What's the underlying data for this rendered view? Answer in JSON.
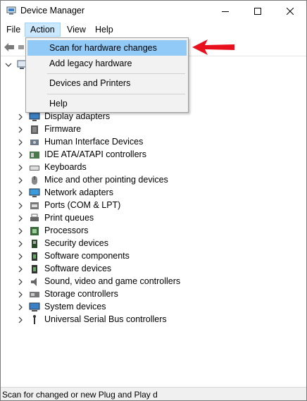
{
  "window": {
    "title": "Device Manager"
  },
  "menubar": {
    "file": "File",
    "action": "Action",
    "view": "View",
    "help": "Help"
  },
  "dropdown": {
    "scan": "Scan for hardware changes",
    "legacy": "Add legacy hardware",
    "devices_printers": "Devices and Printers",
    "help": "Help"
  },
  "tree": {
    "items": [
      {
        "label": "Display adapters",
        "icon": "display-adapter-icon"
      },
      {
        "label": "Firmware",
        "icon": "firmware-icon"
      },
      {
        "label": "Human Interface Devices",
        "icon": "hid-icon"
      },
      {
        "label": "IDE ATA/ATAPI controllers",
        "icon": "ide-controller-icon"
      },
      {
        "label": "Keyboards",
        "icon": "keyboard-icon"
      },
      {
        "label": "Mice and other pointing devices",
        "icon": "mouse-icon"
      },
      {
        "label": "Network adapters",
        "icon": "network-adapter-icon"
      },
      {
        "label": "Ports (COM & LPT)",
        "icon": "port-icon"
      },
      {
        "label": "Print queues",
        "icon": "printer-icon"
      },
      {
        "label": "Processors",
        "icon": "processor-icon"
      },
      {
        "label": "Security devices",
        "icon": "security-device-icon"
      },
      {
        "label": "Software components",
        "icon": "software-component-icon"
      },
      {
        "label": "Software devices",
        "icon": "software-device-icon"
      },
      {
        "label": "Sound, video and game controllers",
        "icon": "sound-icon"
      },
      {
        "label": "Storage controllers",
        "icon": "storage-controller-icon"
      },
      {
        "label": "System devices",
        "icon": "system-device-icon"
      },
      {
        "label": "Universal Serial Bus controllers",
        "icon": "usb-icon"
      }
    ]
  },
  "status": {
    "text": "Scan for changed or new Plug and Play d"
  },
  "colors": {
    "menu_highlight": "#91c9f7",
    "action_active": "#cce8ff",
    "arrow": "#e8101c"
  }
}
